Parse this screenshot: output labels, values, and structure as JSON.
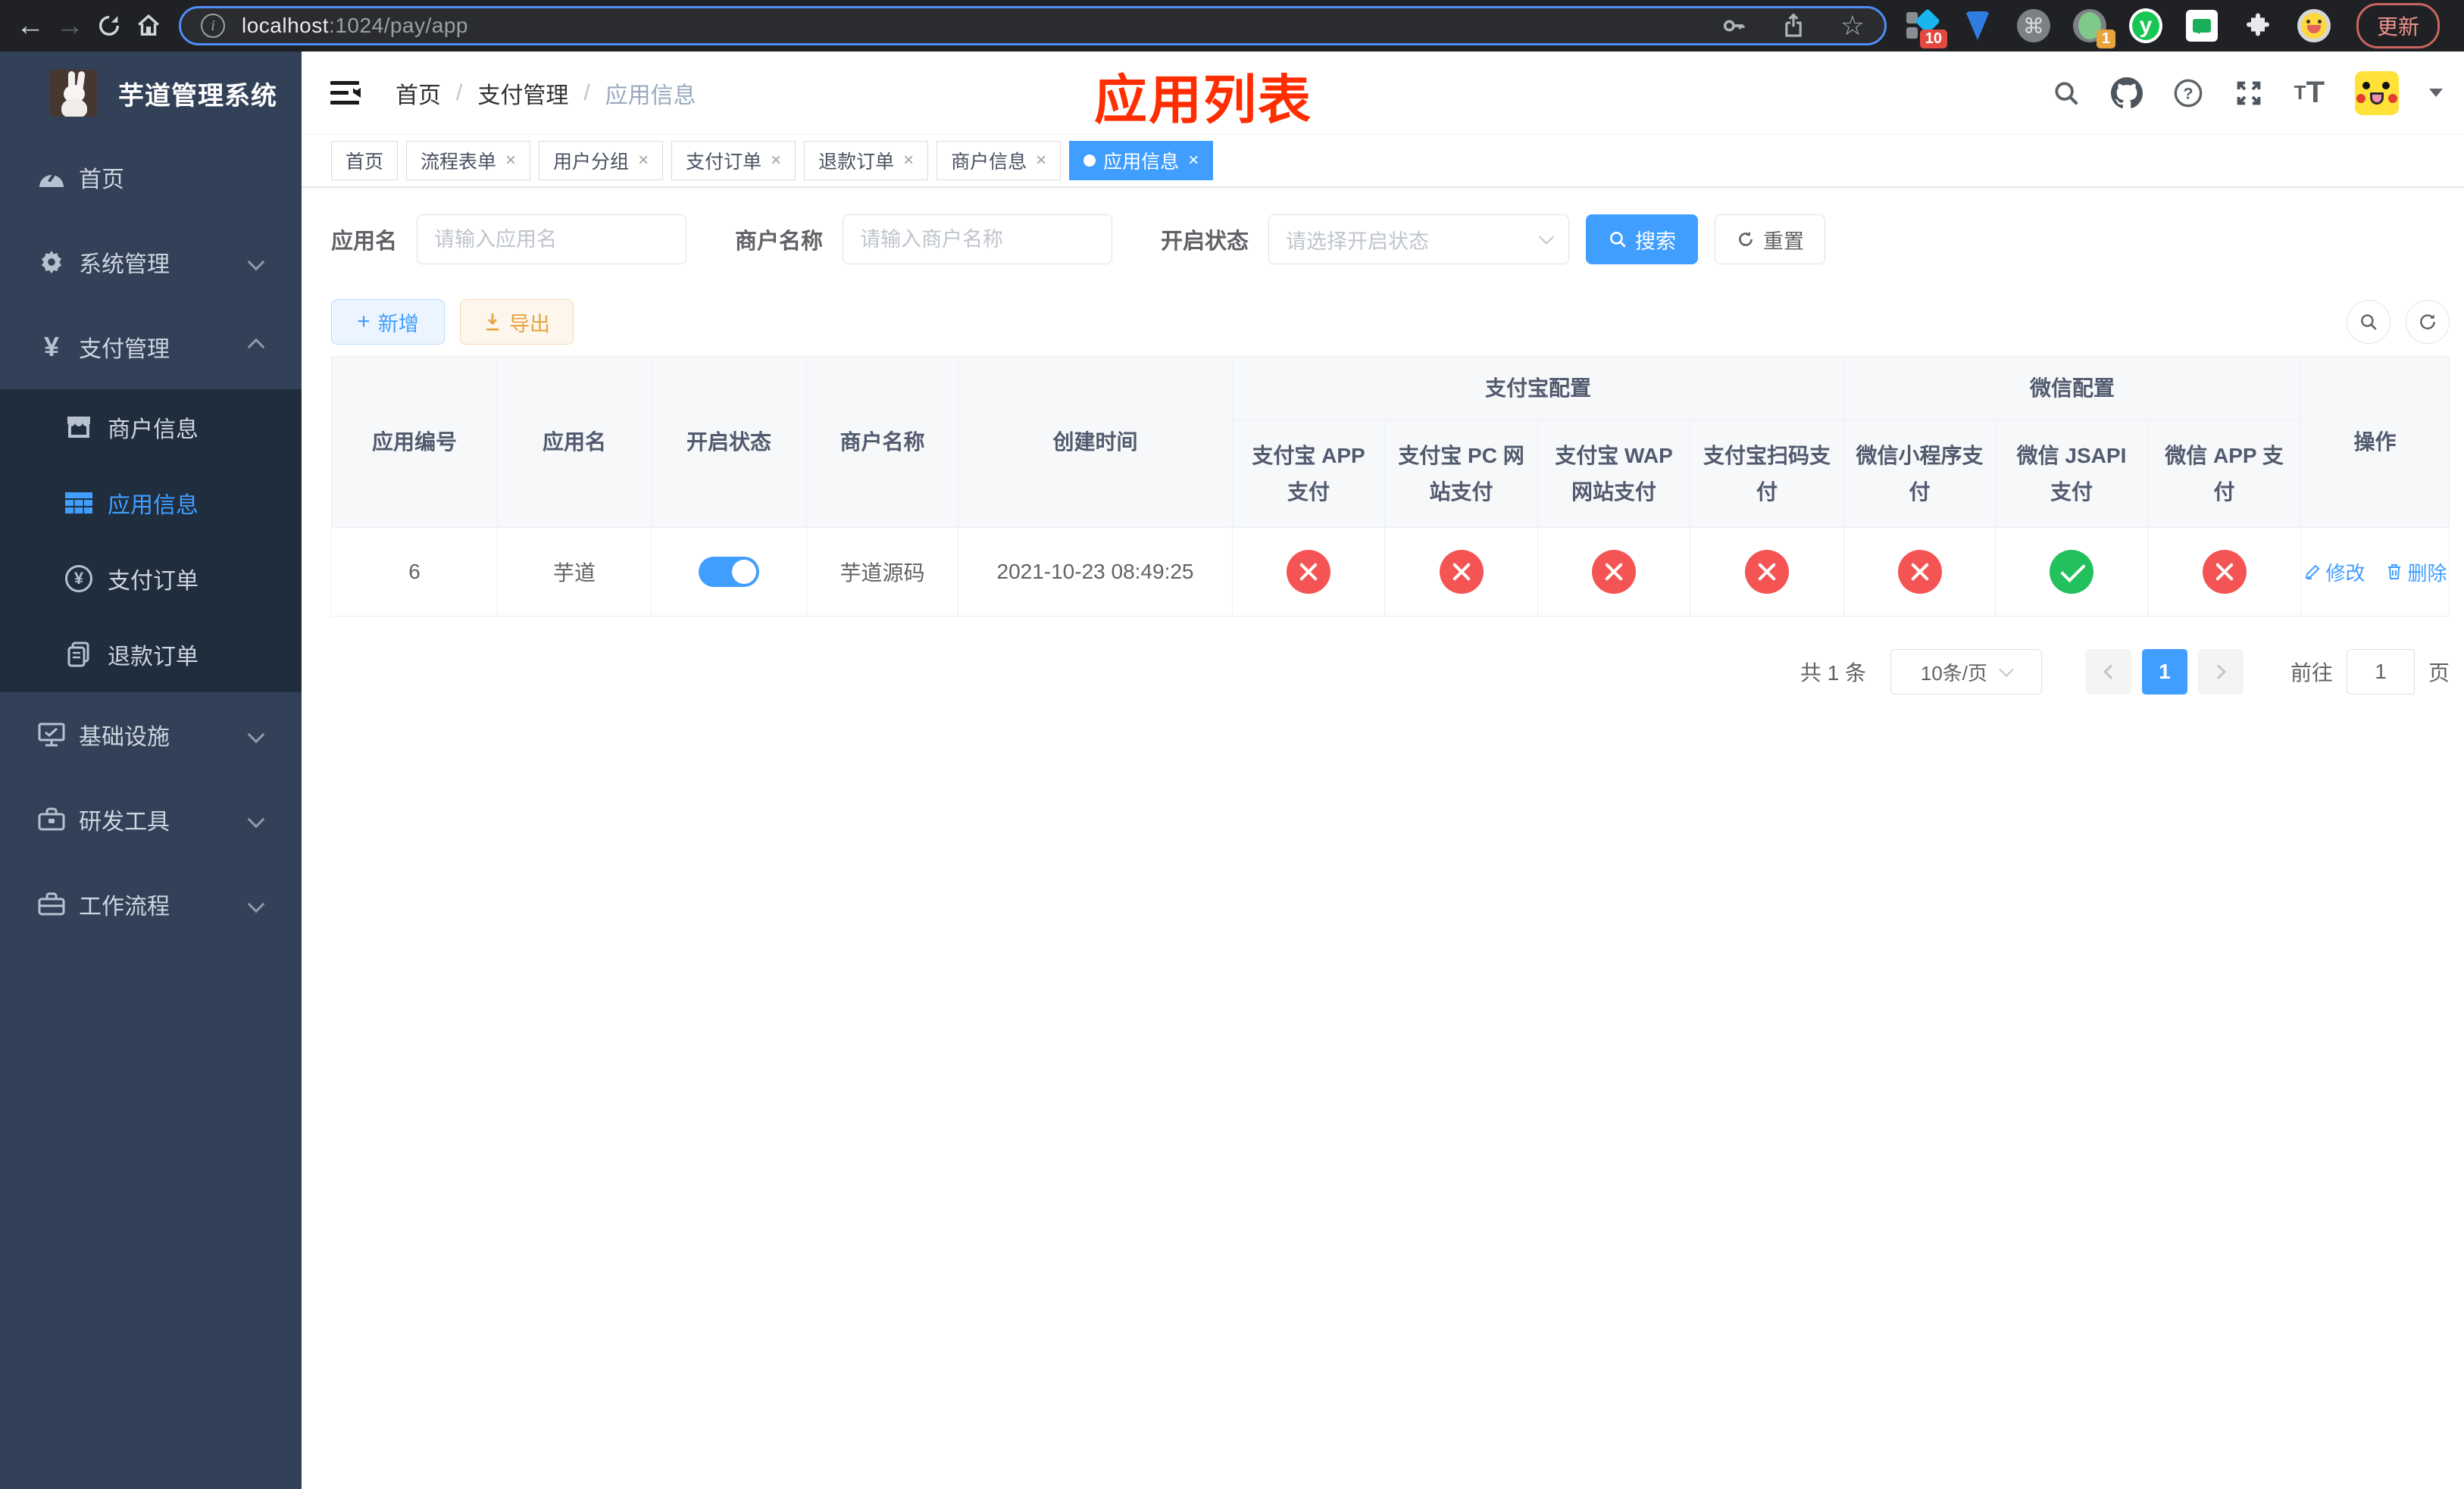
{
  "browser": {
    "url_host": "localhost",
    "url_rest": ":1024/pay/app",
    "ext_badge_blocks": "10",
    "ext_badge_record": "1",
    "ext_y_letter": "y",
    "command_glyph": "⌘",
    "update_label": "更新"
  },
  "sidebar": {
    "title": "芋道管理系统",
    "items": [
      {
        "label": "首页"
      },
      {
        "label": "系统管理"
      },
      {
        "label": "支付管理"
      }
    ],
    "submenu": [
      {
        "label": "商户信息"
      },
      {
        "label": "应用信息"
      },
      {
        "label": "支付订单"
      },
      {
        "label": "退款订单"
      }
    ],
    "items_after": [
      {
        "label": "基础设施"
      },
      {
        "label": "研发工具"
      },
      {
        "label": "工作流程"
      }
    ]
  },
  "topbar": {
    "breadcrumb": {
      "home": "首页",
      "parent": "支付管理",
      "current": "应用信息"
    },
    "annotation": "应用列表"
  },
  "tabs": [
    {
      "label": "首页"
    },
    {
      "label": "流程表单"
    },
    {
      "label": "用户分组"
    },
    {
      "label": "支付订单"
    },
    {
      "label": "退款订单"
    },
    {
      "label": "商户信息"
    },
    {
      "label": "应用信息"
    }
  ],
  "filters": {
    "app_name_label": "应用名",
    "app_name_placeholder": "请输入应用名",
    "merchant_label": "商户名称",
    "merchant_placeholder": "请输入商户名称",
    "status_label": "开启状态",
    "status_placeholder": "请选择开启状态",
    "search_label": "搜索",
    "reset_label": "重置"
  },
  "toolbar": {
    "add_label": "新增",
    "export_label": "导出"
  },
  "table": {
    "col_id": "应用编号",
    "col_name": "应用名",
    "col_status": "开启状态",
    "col_merchant": "商户名称",
    "col_created": "创建时间",
    "group_alipay": "支付宝配置",
    "alipay_cols": [
      "支付宝 APP 支付",
      "支付宝 PC 网站支付",
      "支付宝 WAP 网站支付",
      "支付宝扫码支付"
    ],
    "group_wechat": "微信配置",
    "wechat_cols": [
      "微信小程序支付",
      "微信 JSAPI 支付",
      "微信 APP 支付"
    ],
    "col_actions": "操作",
    "row": {
      "id": "6",
      "name": "芋道",
      "status_on": true,
      "merchant": "芋道源码",
      "created": "2021-10-23 08:49:25",
      "pay_status": [
        "no",
        "no",
        "no",
        "no",
        "no",
        "yes",
        "no"
      ],
      "edit_label": "修改",
      "delete_label": "删除"
    }
  },
  "pagination": {
    "total": "共 1 条",
    "page_size": "10条/页",
    "page": "1",
    "goto_label": "前往",
    "goto_value": "1",
    "unit_label": "页"
  },
  "colors": {
    "accent_blue": "#409eff",
    "sidebar_bg": "#324157",
    "submenu_bg": "#1f2d3d",
    "danger_red": "#f45454",
    "success_green": "#23c05e",
    "warning_orange": "#e6a23c",
    "annotation_red": "#ff2d00"
  }
}
